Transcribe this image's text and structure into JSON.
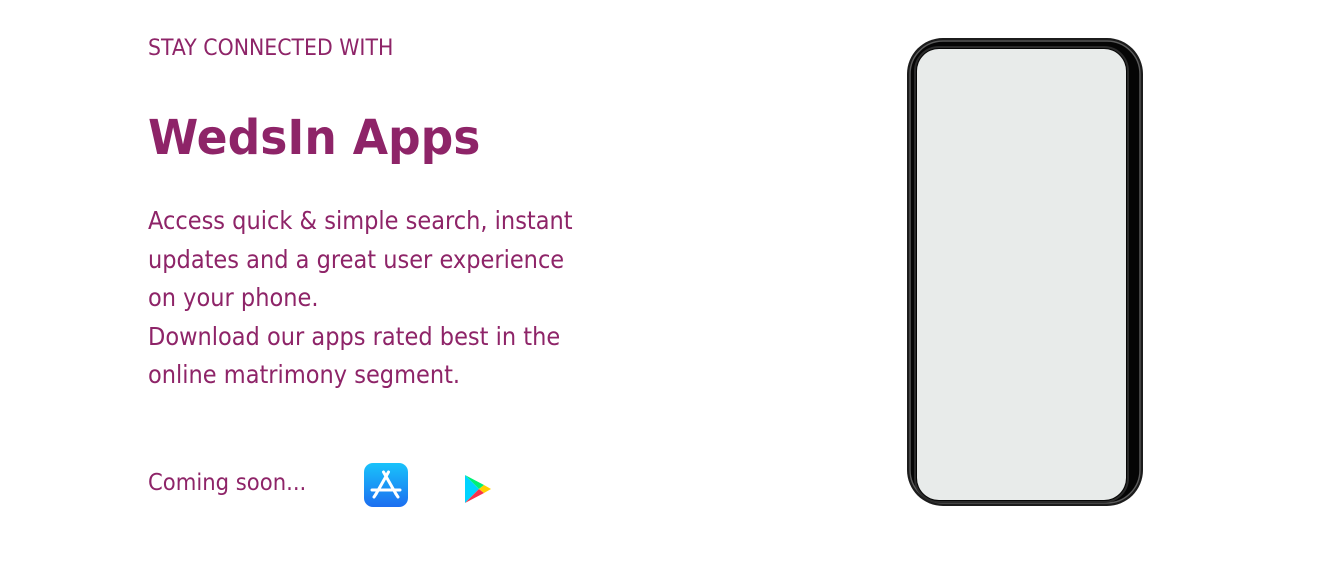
{
  "promo": {
    "eyebrow": "STAY CONNECTED WITH",
    "title": "WedsIn Apps",
    "description_lines": [
      "Access quick & simple search, instant",
      "updates and a great user experience",
      "on your phone.",
      "Download our apps rated best in the",
      "online matrimony segment."
    ],
    "coming_soon": "Coming soon..."
  },
  "stores": {
    "app_store_icon": "app-store-icon",
    "play_store_icon": "google-play-icon"
  },
  "colors": {
    "text": "#8e2468",
    "app_store_blue": "#1d8ff0",
    "phone_screen": "#e8ebea",
    "phone_frame": "#0c0c0c"
  }
}
